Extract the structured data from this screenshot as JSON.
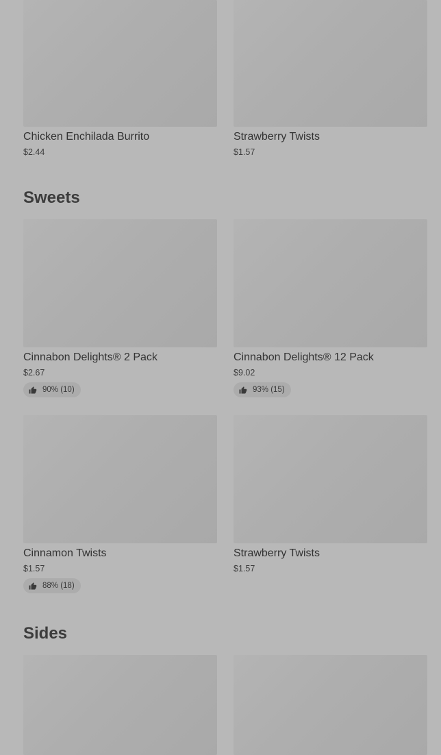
{
  "top_items": [
    {
      "name": "Chicken Enchilada Burrito",
      "price": "$2.44"
    },
    {
      "name": "Strawberry Twists",
      "price": "$1.57"
    }
  ],
  "sweets": {
    "title": "Sweets",
    "items": [
      {
        "name": "Cinnabon Delights® 2 Pack",
        "price": "$2.67",
        "rating": "90% (10)"
      },
      {
        "name": "Cinnabon Delights® 12 Pack",
        "price": "$9.02",
        "rating": "93% (15)"
      },
      {
        "name": "Cinnamon Twists",
        "price": "$1.57",
        "rating": "88% (18)"
      },
      {
        "name": "Strawberry Twists",
        "price": "$1.57"
      }
    ]
  },
  "sides": {
    "title": "Sides"
  }
}
